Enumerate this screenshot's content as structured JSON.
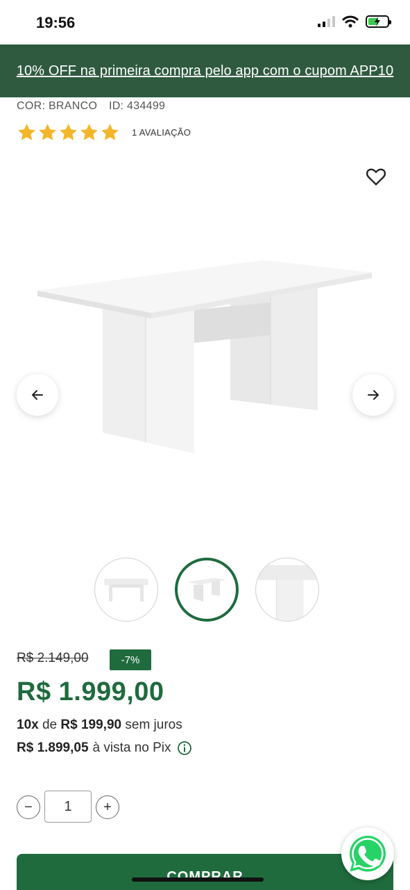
{
  "status_bar": {
    "time": "19:56",
    "battery_level": 0.45
  },
  "promo": {
    "text": "10% OFF na primeira compra pelo app com o cupom APP10"
  },
  "product": {
    "color_label": "COR: BRANCO",
    "id_label": "ID: 434499",
    "rating": 5,
    "rating_max": 5,
    "reviews_label": "1 AVALIAÇÃO"
  },
  "gallery": {
    "thumbnail_count": 3,
    "active_index": 1
  },
  "pricing": {
    "old_price": "R$ 2.149,00",
    "discount": "-7%",
    "price": "R$ 1.999,00",
    "installments_count": "10x",
    "installments_of": "de",
    "installment_value": "R$ 199,90",
    "installments_suffix": "sem juros",
    "pix_price": "R$ 1.899,05",
    "pix_suffix": "à vista no Pix"
  },
  "quantity": {
    "value": "1",
    "minus": "−",
    "plus": "+"
  },
  "buy_button": {
    "label": "COMPRAR"
  },
  "icons": {
    "favorite": "heart-icon",
    "prev": "arrow-left-icon",
    "next": "arrow-right-icon",
    "info": "info-icon",
    "chat": "whatsapp-icon"
  },
  "colors": {
    "brand_green": "#1f6b3e",
    "banner_green": "#2f5a3f",
    "star": "#f3b62a"
  }
}
